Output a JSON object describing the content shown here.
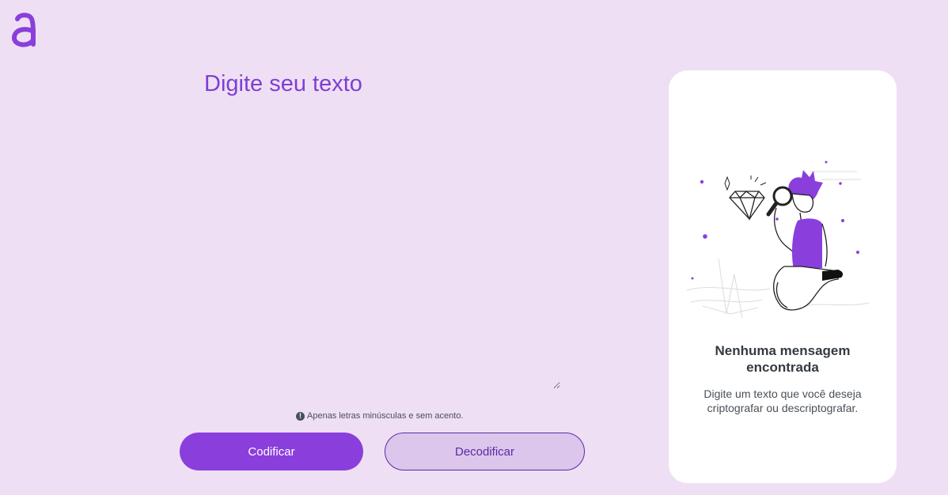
{
  "brand": {
    "logo_icon": "alura-logo-icon",
    "accent_color": "#8a3fdc"
  },
  "input": {
    "title": "Digite seu texto",
    "value": ""
  },
  "hint": {
    "icon": "exclamation-circle-icon",
    "text": "Apenas letras minúsculas e sem acento."
  },
  "actions": {
    "encrypt_label": "Codificar",
    "decrypt_label": "Decodificar"
  },
  "output": {
    "illustration_icon": "person-with-magnifier-illustration",
    "title": "Nenhuma mensagem encontrada",
    "description": "Digite um texto que você deseja criptografar ou descriptografar."
  }
}
